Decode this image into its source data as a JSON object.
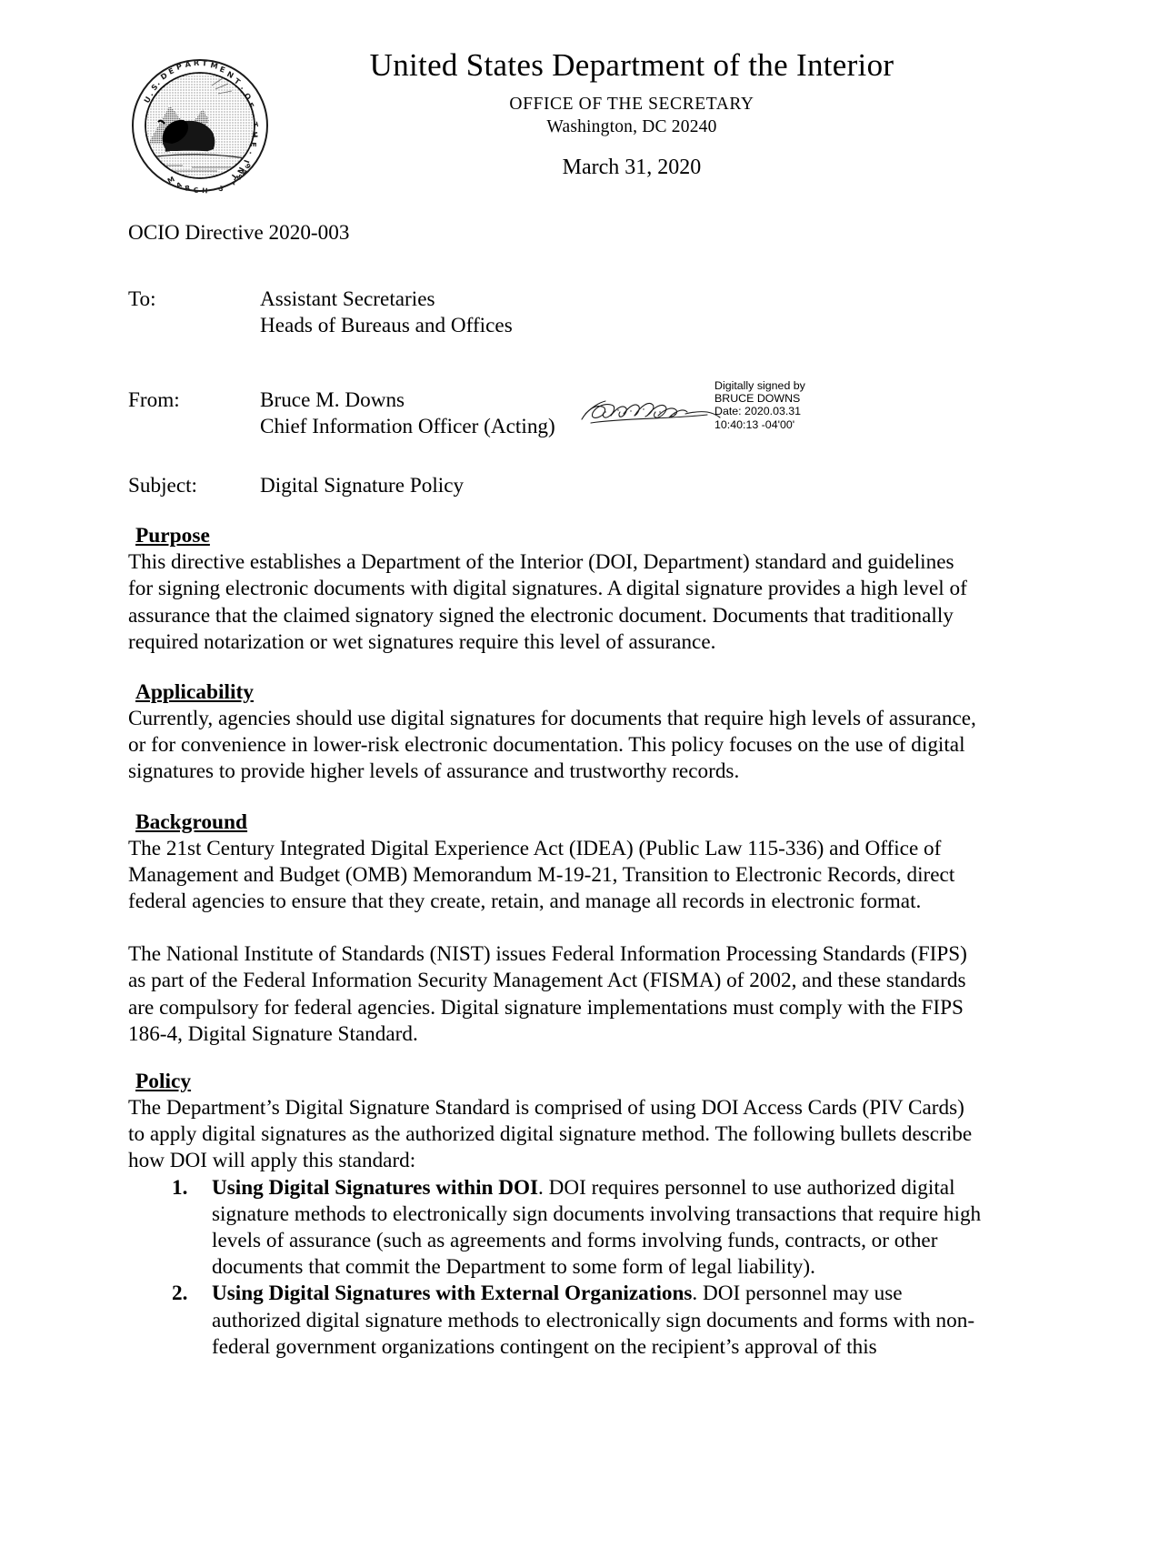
{
  "letterhead": {
    "seal_alt": "Department of the Interior seal with bison, U.S. DEPARTMENT OF THE INTERIOR, MARCH 3 1849",
    "title": "United States Department of the Interior",
    "office": "OFFICE OF THE SECRETARY",
    "city_state_zip": "Washington, DC 20240",
    "date": "March 31, 2020"
  },
  "memo": {
    "directive_number": "OCIO Directive 2020-003",
    "to_label": "To:",
    "to_lines": [
      "Assistant Secretaries",
      "Heads of Bureaus and Offices"
    ],
    "from_label": "From:",
    "from_lines": [
      "Bruce M. Downs",
      "Chief Information Officer (Acting)"
    ],
    "subject_label": "Subject:",
    "subject_value": "Digital Signature Policy"
  },
  "signature_stamp": {
    "line1": "Digitally signed by",
    "line2": "BRUCE DOWNS",
    "line3": "Date: 2020.03.31",
    "line4": "10:40:13 -04'00'",
    "handwritten_name": "Bruce M. Downs"
  },
  "sections": [
    {
      "heading": "Purpose",
      "paragraphs": [
        "This directive establishes a Department of the Interior (DOI, Department) standard and guidelines for signing electronic documents with digital signatures.  A digital signature provides a high level of assurance that the claimed signatory signed the electronic document.  Documents that traditionally required notarization or wet signatures require this level of assurance."
      ]
    },
    {
      "heading": "Applicability",
      "paragraphs": [
        "Currently, agencies should use digital signatures for documents that require high levels of assurance, or for convenience in lower-risk electronic documentation.  This policy focuses on the use of digital signatures to provide higher levels of assurance and trustworthy records."
      ]
    },
    {
      "heading": "Background",
      "paragraphs": [
        "The 21st Century Integrated Digital Experience Act (IDEA) (Public Law 115-336) and Office of Management and Budget (OMB) Memorandum M-19-21, Transition to Electronic Records, direct federal agencies to ensure that they create, retain, and manage all records in electronic format.",
        "The National Institute of Standards (NIST) issues Federal Information Processing Standards (FIPS) as part of the Federal Information Security Management Act (FISMA) of 2002, and these standards are compulsory for federal agencies.  Digital signature implementations must comply with the FIPS 186-4, Digital Signature Standard."
      ]
    },
    {
      "heading": "Policy",
      "paragraphs": [
        "The Department’s Digital Signature Standard is comprised of using DOI Access Cards (PIV Cards) to apply digital signatures as the authorized digital signature method.  The following bullets describe how DOI will apply this standard:"
      ]
    }
  ],
  "policy_list": [
    {
      "number": "1.",
      "lead": "Using Digital Signatures within DOI",
      "body": ".  DOI requires personnel to use authorized digital signature methods to electronically sign documents involving transactions that require high levels of assurance (such as agreements and forms involving funds, contracts, or other documents that commit the Department to some form of legal liability)."
    },
    {
      "number": "2.",
      "lead": "Using Digital Signatures with External Organizations",
      "body": ".  DOI personnel may use authorized digital signature methods to electronically sign documents and forms with non-federal government organizations contingent on the recipient’s approval of this"
    }
  ]
}
